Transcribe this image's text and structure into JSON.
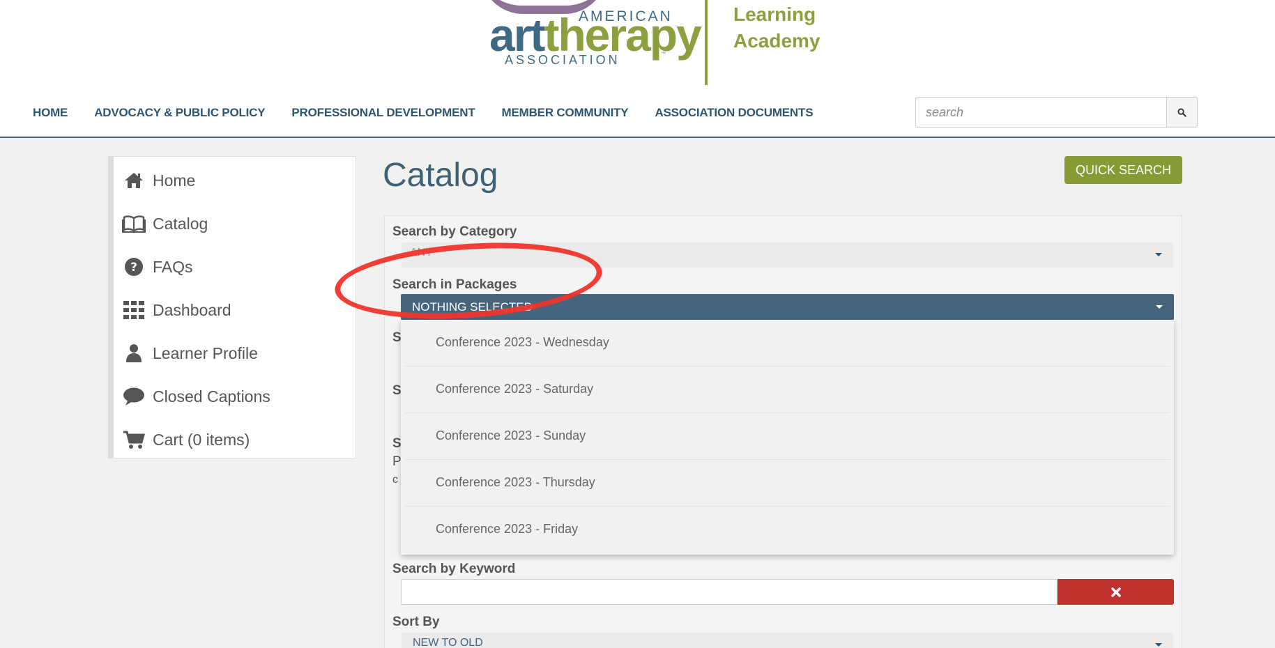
{
  "logo": {
    "american": "AMERICAN",
    "art": "art",
    "therapy": "therapy",
    "tm": "™",
    "association": "ASSOCIATION",
    "learning_line1": "Learning",
    "learning_line2": "Academy"
  },
  "nav": {
    "items": [
      "HOME",
      "ADVOCACY & PUBLIC POLICY",
      "PROFESSIONAL DEVELOPMENT",
      "MEMBER COMMUNITY",
      "ASSOCIATION DOCUMENTS"
    ]
  },
  "search": {
    "placeholder": "search",
    "icon": "search-icon"
  },
  "sidebar": {
    "items": [
      {
        "label": "Home",
        "icon": "home-icon"
      },
      {
        "label": "Catalog",
        "icon": "book-icon"
      },
      {
        "label": "FAQs",
        "icon": "question-icon"
      },
      {
        "label": "Dashboard",
        "icon": "grid-icon"
      },
      {
        "label": "Learner Profile",
        "icon": "user-icon"
      },
      {
        "label": "Closed Captions",
        "icon": "speech-bubble-icon"
      },
      {
        "label": "Cart (0 items)",
        "icon": "cart-icon"
      }
    ]
  },
  "main": {
    "title": "Catalog",
    "quick_search": "QUICK SEARCH",
    "category_label": "Search by Category",
    "category_value": "ANY",
    "packages_label": "Search in Packages",
    "packages_value": "NOTHING SELECTED",
    "package_options": [
      "Conference 2023 - Wednesday",
      "Conference 2023 - Saturday",
      "Conference 2023 - Sunday",
      "Conference 2023 - Thursday",
      "Conference 2023 - Friday"
    ],
    "obscured_letters": [
      "S",
      "S",
      "S",
      "P",
      "c"
    ],
    "keyword_label": "Search by Keyword",
    "keyword_value": "",
    "clear_icon": "close-icon",
    "sort_label": "Sort By",
    "sort_value": "NEW TO OLD"
  },
  "colors": {
    "brand_blue": "#3f6a86",
    "brand_green": "#8da040",
    "select_active": "#46657c",
    "clear_red": "#c0302c",
    "annotation_red": "#f0352c"
  }
}
